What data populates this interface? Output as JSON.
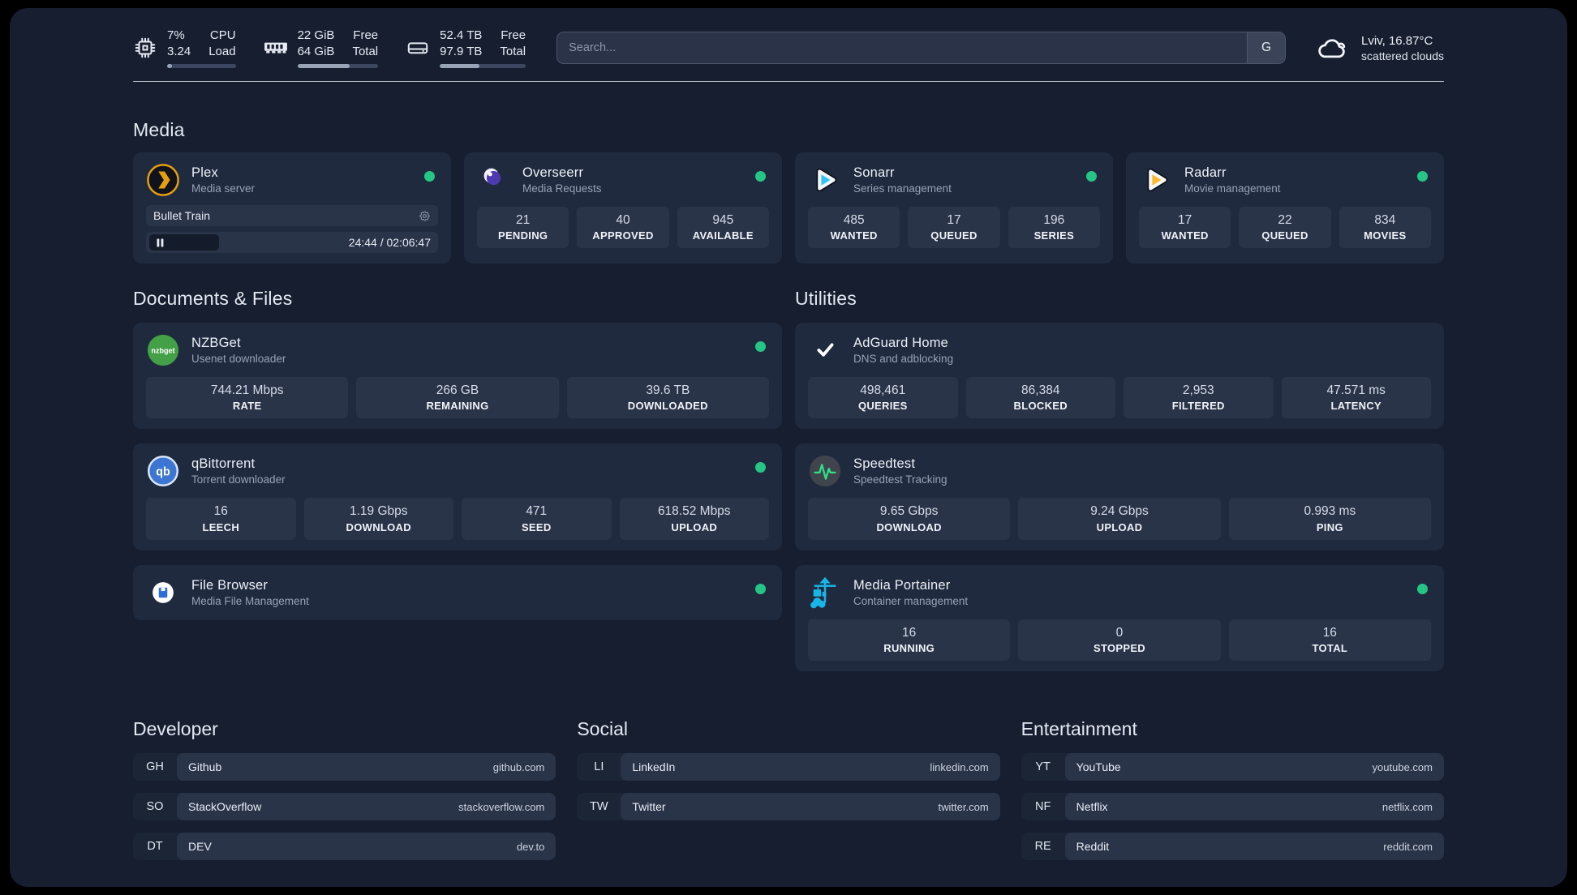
{
  "header": {
    "cpu": {
      "v1": "7%",
      "v2": "3.24",
      "l1": "CPU",
      "l2": "Load",
      "progress_pct": 7
    },
    "memory": {
      "v1": "22 GiB",
      "v2": "64 GiB",
      "l1": "Free",
      "l2": "Total",
      "progress_pct": 65
    },
    "disk": {
      "v1": "52.4 TB",
      "v2": "97.9 TB",
      "l1": "Free",
      "l2": "Total",
      "progress_pct": 46
    },
    "search": {
      "placeholder": "Search...",
      "provider_button": "G"
    },
    "weather": {
      "title": "Lviv, 16.87°C",
      "subtitle": "scattered clouds"
    }
  },
  "services": {
    "media": {
      "heading": "Media",
      "cards": [
        {
          "id": "plex",
          "icon": "plex",
          "title": "Plex",
          "subtitle": "Media server",
          "status_dot": true,
          "media_widget": {
            "now_playing": "Bullet Train",
            "position": "24:44",
            "duration": "02:06:47",
            "state": "paused"
          }
        },
        {
          "id": "overseerr",
          "icon": "overseerr",
          "title": "Overseerr",
          "subtitle": "Media Requests",
          "status_dot": true,
          "stats": [
            {
              "value": "21",
              "label": "PENDING"
            },
            {
              "value": "40",
              "label": "APPROVED"
            },
            {
              "value": "945",
              "label": "AVAILABLE"
            }
          ]
        },
        {
          "id": "sonarr",
          "icon": "sonarr",
          "title": "Sonarr",
          "subtitle": "Series management",
          "status_dot": true,
          "stats": [
            {
              "value": "485",
              "label": "WANTED"
            },
            {
              "value": "17",
              "label": "QUEUED"
            },
            {
              "value": "196",
              "label": "SERIES"
            }
          ]
        },
        {
          "id": "radarr",
          "icon": "radarr",
          "title": "Radarr",
          "subtitle": "Movie management",
          "status_dot": true,
          "stats": [
            {
              "value": "17",
              "label": "WANTED"
            },
            {
              "value": "22",
              "label": "QUEUED"
            },
            {
              "value": "834",
              "label": "MOVIES"
            }
          ]
        }
      ]
    },
    "documents": {
      "heading": "Documents & Files",
      "cards": [
        {
          "id": "nzbget",
          "icon": "nzbget",
          "title": "NZBGet",
          "subtitle": "Usenet downloader",
          "status_dot": true,
          "stats": [
            {
              "value": "744.21 Mbps",
              "label": "RATE"
            },
            {
              "value": "266 GB",
              "label": "REMAINING"
            },
            {
              "value": "39.6 TB",
              "label": "DOWNLOADED"
            }
          ]
        },
        {
          "id": "qbittorrent",
          "icon": "qbittorrent",
          "title": "qBittorrent",
          "subtitle": "Torrent downloader",
          "status_dot": true,
          "stats": [
            {
              "value": "16",
              "label": "LEECH"
            },
            {
              "value": "1.19 Gbps",
              "label": "DOWNLOAD"
            },
            {
              "value": "471",
              "label": "SEED"
            },
            {
              "value": "618.52 Mbps",
              "label": "UPLOAD"
            }
          ]
        },
        {
          "id": "filebrowser",
          "icon": "filebrowser",
          "title": "File Browser",
          "subtitle": "Media File Management",
          "status_dot": true
        }
      ]
    },
    "utilities": {
      "heading": "Utilities",
      "cards": [
        {
          "id": "adguard",
          "icon": "adguard",
          "title": "AdGuard Home",
          "subtitle": "DNS and adblocking",
          "status_dot": false,
          "stats": [
            {
              "value": "498,461",
              "label": "QUERIES"
            },
            {
              "value": "86,384",
              "label": "BLOCKED"
            },
            {
              "value": "2,953",
              "label": "FILTERED"
            },
            {
              "value": "47.571 ms",
              "label": "LATENCY"
            }
          ]
        },
        {
          "id": "speedtest",
          "icon": "speedtest",
          "title": "Speedtest",
          "subtitle": "Speedtest Tracking",
          "status_dot": false,
          "stats": [
            {
              "value": "9.65 Gbps",
              "label": "DOWNLOAD"
            },
            {
              "value": "9.24 Gbps",
              "label": "UPLOAD"
            },
            {
              "value": "0.993 ms",
              "label": "PING"
            }
          ]
        },
        {
          "id": "portainer",
          "icon": "portainer",
          "title": "Media Portainer",
          "subtitle": "Container management",
          "status_dot": true,
          "stats": [
            {
              "value": "16",
              "label": "RUNNING"
            },
            {
              "value": "0",
              "label": "STOPPED"
            },
            {
              "value": "16",
              "label": "TOTAL"
            }
          ]
        }
      ]
    }
  },
  "bookmarks": {
    "groups": [
      {
        "heading": "Developer",
        "items": [
          {
            "abbr": "GH",
            "name": "Github",
            "url": "github.com"
          },
          {
            "abbr": "SO",
            "name": "StackOverflow",
            "url": "stackoverflow.com"
          },
          {
            "abbr": "DT",
            "name": "DEV",
            "url": "dev.to"
          }
        ]
      },
      {
        "heading": "Social",
        "items": [
          {
            "abbr": "LI",
            "name": "LinkedIn",
            "url": "linkedin.com"
          },
          {
            "abbr": "TW",
            "name": "Twitter",
            "url": "twitter.com"
          }
        ]
      },
      {
        "heading": "Entertainment",
        "items": [
          {
            "abbr": "YT",
            "name": "YouTube",
            "url": "youtube.com"
          },
          {
            "abbr": "NF",
            "name": "Netflix",
            "url": "netflix.com"
          },
          {
            "abbr": "RE",
            "name": "Reddit",
            "url": "reddit.com"
          }
        ]
      }
    ]
  },
  "colors": {
    "status_online": "#25c685",
    "plex_accent": "#e5a00d",
    "sonarr_accent": "#36c3f2",
    "radarr_accent": "#f9b92c",
    "overseerr_accent": "#7b5cd6",
    "adguard_accent": "#55b554",
    "portainer_accent": "#19b5e8",
    "speedtest_accent": "#30e087",
    "nzbget_accent": "#43a047",
    "qbittorrent_accent": "#3c76d2",
    "filebrowser_accent": "#2d6fd9"
  }
}
